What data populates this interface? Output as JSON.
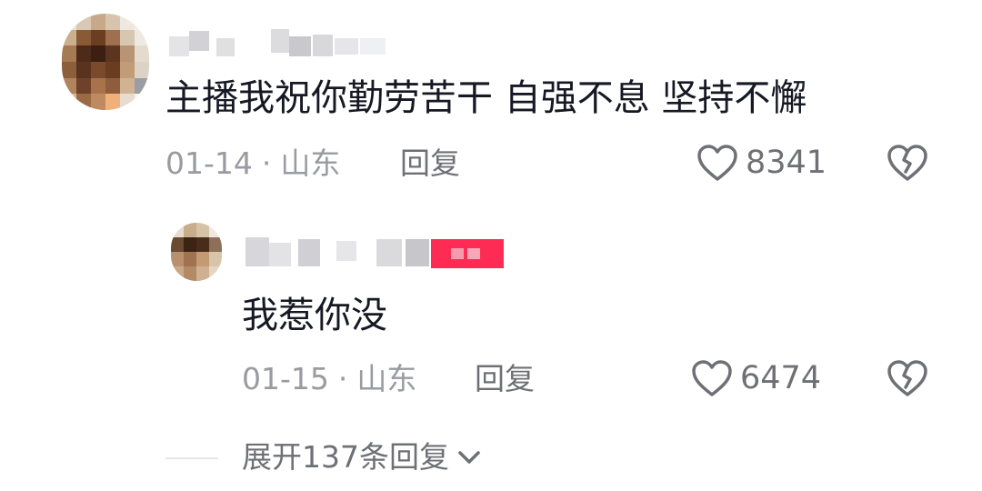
{
  "comments": [
    {
      "text": "主播我祝你勤劳苦干 自强不息 坚持不懈",
      "date": "01-14",
      "separator": "·",
      "location": "山东",
      "reply_label": "回复",
      "like_count": "8341"
    }
  ],
  "reply": {
    "text": "我惹你没",
    "date": "01-15",
    "separator": "·",
    "location": "山东",
    "reply_label": "回复",
    "like_count": "6474"
  },
  "expand": {
    "label": "展开137条回复"
  },
  "colors": {
    "text": "#161823",
    "meta": "#9a9ba0",
    "action": "#6f7075",
    "badge": "#fe2c55"
  }
}
